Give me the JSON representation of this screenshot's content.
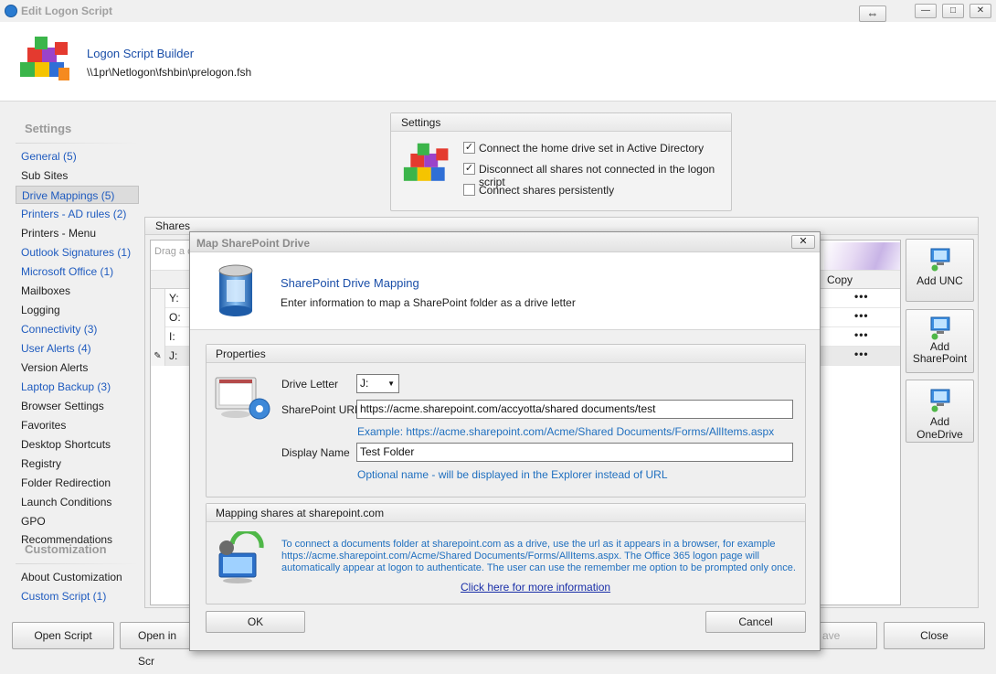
{
  "window": {
    "title": "Edit Logon Script",
    "minimize_glyph": "—",
    "maximize_glyph": "□",
    "close_glyph": "✕",
    "swap_glyph": "⇔"
  },
  "header": {
    "title": "Logon Script Builder",
    "path": "\\\\1pr\\Netlogon\\fshbin\\prelogon.fsh"
  },
  "nav": {
    "settings_heading": "Settings",
    "items": [
      {
        "label": "General (5)",
        "link": true
      },
      {
        "label": "Sub Sites",
        "link": false
      },
      {
        "label": "Drive Mappings (5)",
        "link": true,
        "selected": true
      },
      {
        "label": "Printers - AD rules (2)",
        "link": true
      },
      {
        "label": "Printers - Menu",
        "link": false
      },
      {
        "label": "Outlook Signatures (1)",
        "link": true
      },
      {
        "label": "Microsoft Office (1)",
        "link": true
      },
      {
        "label": "Mailboxes",
        "link": false
      },
      {
        "label": "Logging",
        "link": false
      },
      {
        "label": "Connectivity (3)",
        "link": true
      },
      {
        "label": "User Alerts (4)",
        "link": true
      },
      {
        "label": "Version Alerts",
        "link": false
      },
      {
        "label": "Laptop Backup (3)",
        "link": true
      },
      {
        "label": "Browser Settings",
        "link": false
      },
      {
        "label": "Favorites",
        "link": false
      },
      {
        "label": "Desktop Shortcuts",
        "link": false
      },
      {
        "label": "Registry",
        "link": false
      },
      {
        "label": "Folder Redirection",
        "link": false
      },
      {
        "label": "Launch Conditions",
        "link": false
      },
      {
        "label": "GPO Recommendations",
        "link": false
      }
    ],
    "customization_heading": "Customization",
    "customization_items": [
      {
        "label": "About Customization",
        "link": false
      },
      {
        "label": "Custom Script (1)",
        "link": true
      }
    ]
  },
  "settings_group": {
    "title": "Settings",
    "options": [
      {
        "label": "Connect the home drive set in Active Directory",
        "checked": true
      },
      {
        "label": "Disconnect all shares not connected in the logon script",
        "checked": true
      },
      {
        "label": "Connect shares persistently",
        "checked": false
      }
    ]
  },
  "shares": {
    "title": "Shares",
    "drag_hint": "Drag a c",
    "copy_header": "Copy",
    "rows": [
      {
        "drive": "Y:",
        "copy": "•••"
      },
      {
        "drive": "O:",
        "copy": "•••"
      },
      {
        "drive": "I:",
        "copy": "•••"
      },
      {
        "drive": "J:",
        "copy": "•••",
        "editing": true
      }
    ],
    "buttons": [
      {
        "label": "Add UNC"
      },
      {
        "label": "Add SharePoint"
      },
      {
        "label": "Add OneDrive"
      }
    ]
  },
  "footer": {
    "open_script": "Open Script",
    "open_in": "Open in Scr",
    "save": "ave",
    "close": "Close"
  },
  "dialog": {
    "title": "Map SharePoint Drive",
    "close_glyph": "✕",
    "heading": "SharePoint Drive Mapping",
    "subheading": "Enter information to map a SharePoint folder as a drive letter",
    "properties": {
      "title": "Properties",
      "drive_letter_label": "Drive Letter",
      "drive_letter_value": "J:",
      "url_label": "SharePoint URL",
      "url_value": "https://acme.sharepoint.com/accyotta/shared documents/test",
      "url_example": "Example: https://acme.sharepoint.com/Acme/Shared Documents/Forms/AllItems.aspx",
      "display_name_label": "Display Name",
      "display_name_value": "Test Folder",
      "display_name_hint": "Optional name - will be displayed in the Explorer instead of URL"
    },
    "mapping": {
      "title": "Mapping shares at sharepoint.com",
      "line1": "To connect a documents folder at sharepoint.com as a drive, use the url as it appears in a browser, for example",
      "line2": "https://acme.sharepoint.com/Acme/Shared Documents/Forms/AllItems.aspx. The Office 365 logon page will",
      "line3": "automatically appear at logon to authenticate. The user can use the remember me option to be prompted only once.",
      "link": "Click here for more information"
    },
    "ok": "OK",
    "cancel": "Cancel"
  }
}
